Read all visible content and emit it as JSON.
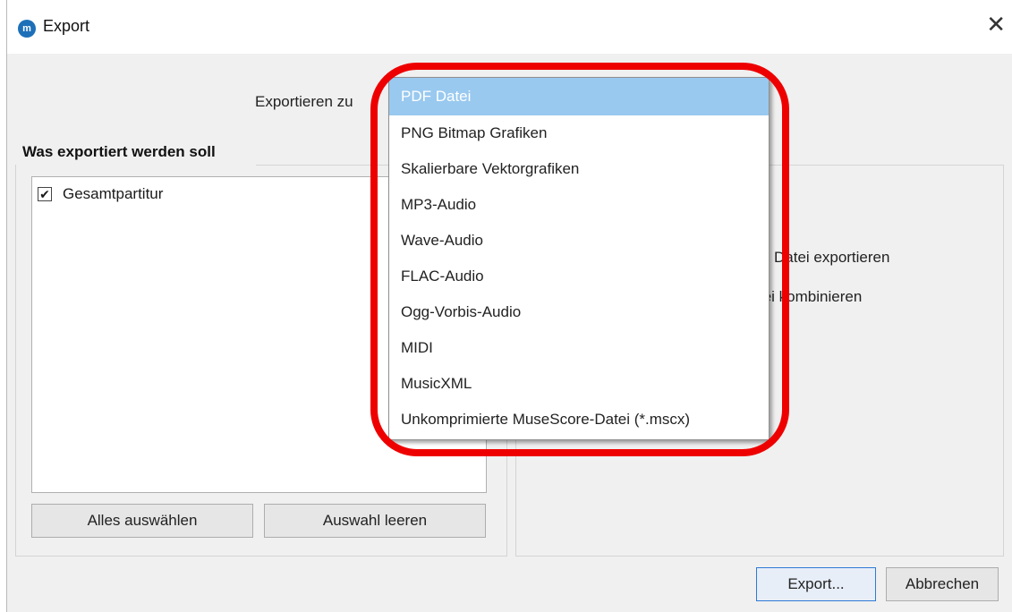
{
  "window": {
    "title": "Export",
    "app_icon_text": "m"
  },
  "export_to": {
    "label": "Exportieren zu"
  },
  "dropdown": {
    "selected_index": 0,
    "options": [
      "PDF Datei",
      "PNG Bitmap Grafiken",
      "Skalierbare Vektorgrafiken",
      "MP3-Audio",
      "Wave-Audio",
      "FLAC-Audio",
      "Ogg-Vorbis-Audio",
      "MIDI",
      "MusicXML",
      "Unkomprimierte MuseScore-Datei (*.mscx)"
    ]
  },
  "what_to_export": {
    "title": "Was exportiert werden soll",
    "items": [
      {
        "label": "Gesamtpartitur",
        "checked": true
      }
    ],
    "select_all_label": "Alles auswählen",
    "clear_selection_label": "Auswahl leeren"
  },
  "options": {
    "option1_partial": "Datei exportieren",
    "option2_partial": "tei kombinieren"
  },
  "buttons": {
    "export": "Export...",
    "cancel": "Abbrechen"
  },
  "colors": {
    "highlight": "#ee0000",
    "selection": "#99c9ef",
    "window_bg": "#f0f0f0"
  }
}
